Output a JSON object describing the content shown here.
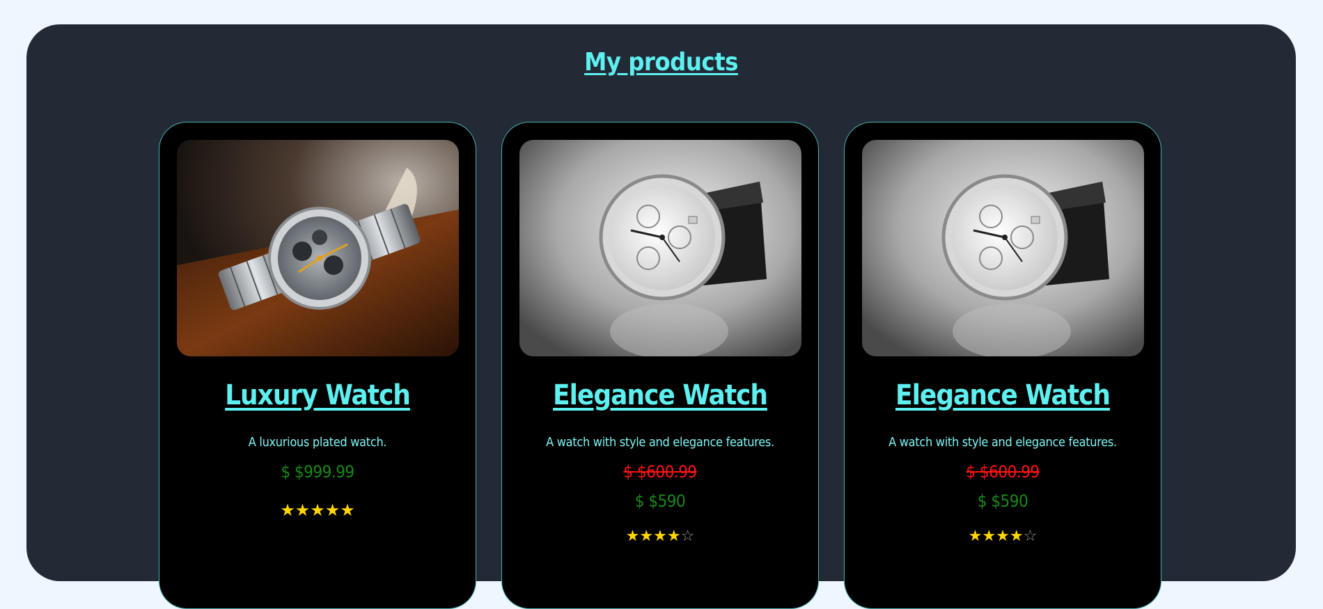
{
  "page": {
    "heading": "My products"
  },
  "colors": {
    "page_background": "#eef6ff",
    "panel_background": "#222a35",
    "accent_cyan": "#5ef0f0",
    "price_green": "#1a8a1a",
    "old_price_red": "#ff1414",
    "star_gold": "#ffd700"
  },
  "products": [
    {
      "title": "Luxury Watch",
      "description": "A luxurious plated watch.",
      "old_price": null,
      "price": "$ $999.99",
      "rating": 5,
      "rating_max": 5,
      "image": "luxury-watch-photo"
    },
    {
      "title": "Elegance Watch",
      "description": "A watch with style and elegance features.",
      "old_price": "$ $600.99",
      "price": "$ $590",
      "rating": 4,
      "rating_max": 5,
      "image": "elegance-watch-photo"
    },
    {
      "title": "Elegance Watch",
      "description": "A watch with style and elegance features.",
      "old_price": "$ $600.99",
      "price": "$ $590",
      "rating": 4,
      "rating_max": 5,
      "image": "elegance-watch-photo"
    }
  ]
}
